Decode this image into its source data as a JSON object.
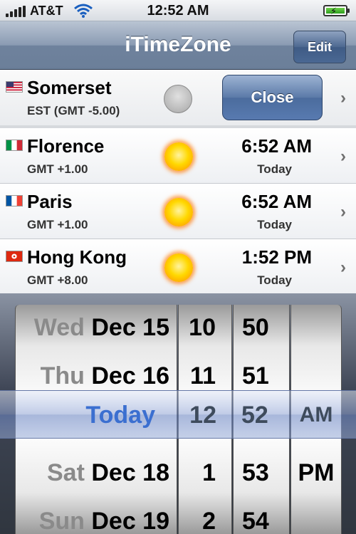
{
  "status_bar": {
    "carrier": "AT&T",
    "time": "12:52 AM"
  },
  "nav": {
    "title": "iTimeZone",
    "edit_label": "Edit"
  },
  "rows": [
    {
      "city": "Somerset",
      "tz": "EST (GMT -5.00)",
      "close_label": "Close",
      "flag": "us-flag-icon",
      "indicator": "moon-icon"
    },
    {
      "city": "Florence",
      "tz": "GMT +1.00",
      "time": "6:52 AM",
      "day": "Today",
      "flag": "italy-flag-icon",
      "indicator": "sun-icon"
    },
    {
      "city": "Paris",
      "tz": "GMT +1.00",
      "time": "6:52 AM",
      "day": "Today",
      "flag": "france-flag-icon",
      "indicator": "sun-icon"
    },
    {
      "city": "Hong Kong",
      "tz": "GMT +8.00",
      "time": "1:52 PM",
      "day": "Today",
      "flag": "hong-kong-flag-icon",
      "indicator": "sun-icon"
    }
  ],
  "picker": {
    "dates": [
      {
        "dow": "Wed",
        "date": "Dec 15"
      },
      {
        "dow": "Thu",
        "date": "Dec 16"
      },
      {
        "dow": "",
        "date": "Today"
      },
      {
        "dow": "Sat",
        "date": "Dec 18"
      },
      {
        "dow": "Sun",
        "date": "Dec 19"
      }
    ],
    "hours": [
      "10",
      "11",
      "12",
      "1",
      "2"
    ],
    "minutes": [
      "50",
      "51",
      "52",
      "53",
      "54"
    ],
    "ampm": [
      "",
      "",
      "AM",
      "PM",
      ""
    ]
  },
  "colors": {
    "nav_accent": "#6b7f99",
    "selected_text": "#3b6fd0",
    "button_blue": "#4b6c9d"
  }
}
